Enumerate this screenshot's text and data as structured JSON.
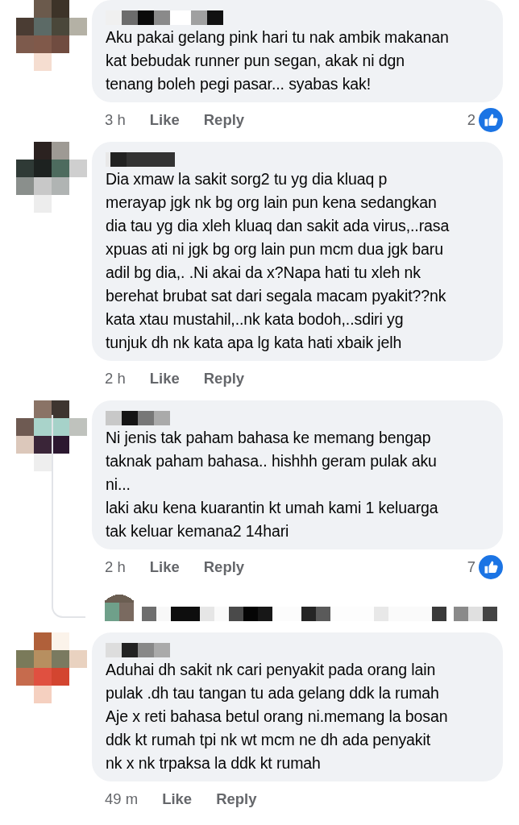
{
  "comments": [
    {
      "text": "Aku pakai gelang pink hari tu nak ambik makanan\nkat bebudak runner pun segan, akak ni dgn\ntenang boleh pegi pasar... syabas kak!",
      "time": "3 h",
      "like": "Like",
      "reply": "Reply",
      "reactions": "2",
      "reply_preview": false
    },
    {
      "text": "Dia xmaw la sakit sorg2 tu yg dia kluaq p\nmerayap jgk nk bg org lain pun kena sedangkan\ndia tau yg dia xleh kluaq dan sakit ada virus,..rasa\nxpuas ati ni jgk bg org lain pun mcm dua jgk baru\nadil bg dia,. .Ni akai da x?Napa hati tu xleh nk\nberehat brubat sat dari segala macam pyakit??nk\nkata xtau mustahil,..nk kata bodoh,..sdiri yg\ntunjuk dh nk kata apa lg kata hati xbaik jelh",
      "time": "2 h",
      "like": "Like",
      "reply": "Reply",
      "reply_preview": false
    },
    {
      "text": "Ni jenis tak paham bahasa ke memang bengap\ntaknak paham bahasa.. hishhh geram pulak aku\nni...\nlaki aku kena kuarantin kt umah kami 1 keluarga\ntak keluar kemana2 14hari",
      "time": "2 h",
      "like": "Like",
      "reply": "Reply",
      "reactions": "7",
      "reply_preview": true
    },
    {
      "text": "Aduhai dh sakit nk cari penyakit pada orang lain\npulak .dh tau tangan tu ada gelang ddk la rumah\nAje x reti bahasa betul orang ni.memang la bosan\nddk kt rumah tpi nk wt mcm ne dh ada penyakit\nnk x nk trpaksa la ddk kt rumah",
      "time": "49 m",
      "like": "Like",
      "reply": "Reply",
      "reply_preview": false
    }
  ]
}
